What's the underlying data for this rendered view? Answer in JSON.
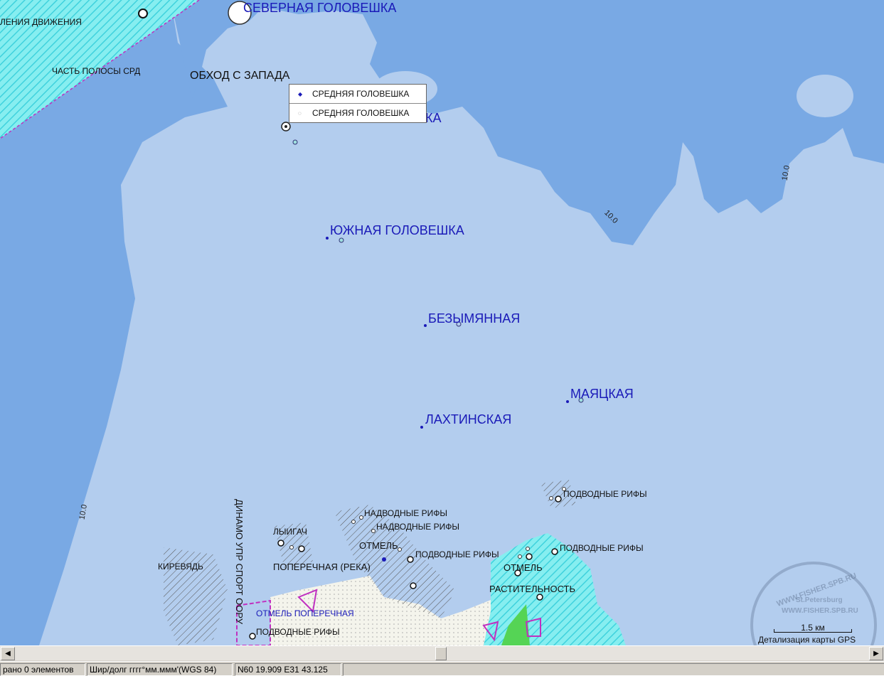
{
  "map": {
    "place_labels": {
      "severnaya": "СЕВЕРНАЯ ГОЛОВЕШКА",
      "obkhod": "ОБХОД С ЗАПАДА",
      "chast_polosy": "ЧАСТЬ ПОЛОСЫ СРД",
      "razdeleniya": "ЛЕНИЯ ДВИЖЕНИЯ",
      "yuzhnaya": "ЮЖНАЯ ГОЛОВЕШКА",
      "bezymyannaya": "БЕЗЫМЯННАЯ",
      "mayatskaya": "МАЯЦКАЯ",
      "lakhtinskaya": "ЛАХТИНСКАЯ",
      "srednyaya_partial": "КА",
      "podvodnye_1": "ПОДВОДНЫЕ РИФЫ",
      "podvodnye_2": "ПОДВОДНЫЕ РИФЫ",
      "podvodnye_3": "ПОДВОДНЫЕ РИФЫ",
      "podvodnye_4": "ПОДВОДНЫЕ РИФЫ",
      "nadvodnye_1": "НАДВОДНЫЕ РИФЫ",
      "nadvodnye_2": "НАДВОДНЫЕ РИФЫ",
      "otmel_1": "ОТМЕЛЬ",
      "otmel_2": "ОТМЕЛЬ",
      "rastitelnost": "РАСТИТЕЛЬНОСТЬ",
      "lpigach": "ЛЫИГАЧ",
      "kirevyad": "КИРЕВЯДЬ",
      "poperechnaya_reka": "ПОПЕРЕЧНАЯ (РЕКА)",
      "otmel_poperechnaya": "ОТМЕЛЬ ПОПЕРЕЧНАЯ",
      "dinamo": "ДИНАМО УПР СПОРТ ООРУ"
    },
    "depth_labels": {
      "d1": "10.0",
      "d2": "10.0",
      "d3": "10.0"
    },
    "popup": {
      "items": [
        {
          "label": "СРЕДНЯЯ ГОЛОВЕШКА",
          "icon": "diamond-icon"
        },
        {
          "label": "СРЕДНЯЯ ГОЛОВЕШКА",
          "icon": "ring-icon"
        }
      ]
    },
    "scale_label": "1.5 км",
    "detail_label": "Детализация карты GPS",
    "watermark": {
      "line1": "WWW.FISHER.SPB.RU",
      "line2": "St.Petersburg",
      "line3": "WWW.FISHER.SPB.RU"
    },
    "colors": {
      "shallow": "#b3cdee",
      "deep": "#79a9e4",
      "land": "#f5f5ee",
      "hatch_cyan": "#5fe8ee",
      "label_blue": "#1a1ab8"
    }
  },
  "status": {
    "selected": "рано 0 элементов",
    "format": "Шир/долг гггг°мм.ммм'(WGS 84)",
    "coords": "N60 19.909 E31 43.125"
  }
}
